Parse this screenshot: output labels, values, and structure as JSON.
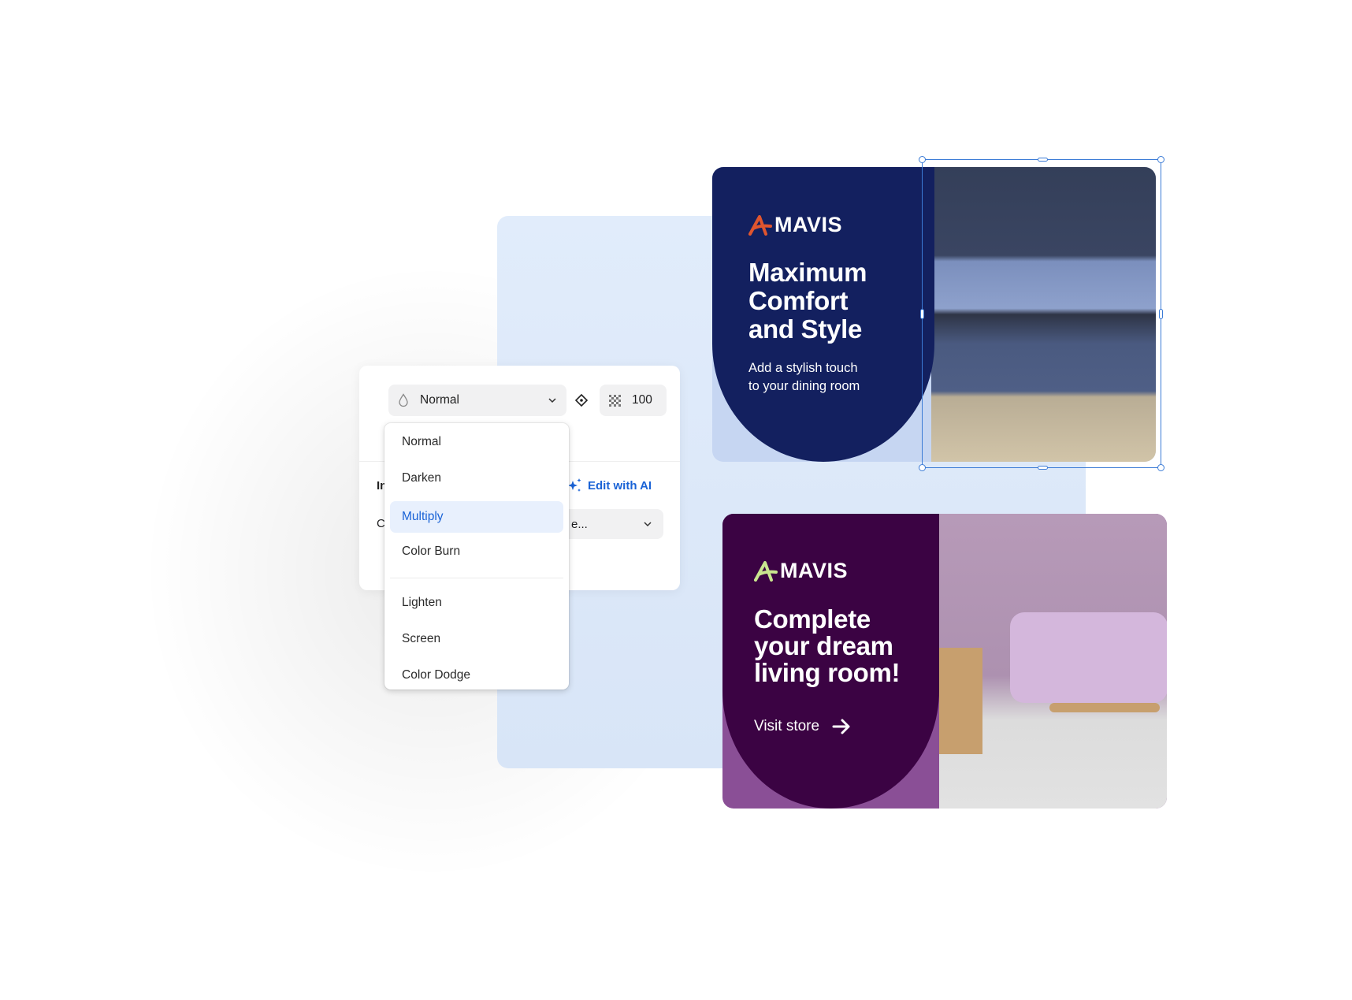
{
  "blend_panel": {
    "blend_mode": "Normal",
    "opacity": "100",
    "label_partial_1": "In",
    "label_partial_2": "C",
    "edit_ai_label": "Edit with AI",
    "second_select_value": "e..."
  },
  "dropdown": {
    "items": [
      "Normal",
      "Darken",
      "Multiply",
      "Color Burn",
      "Lighten",
      "Screen",
      "Color Dodge"
    ],
    "selected": "Multiply"
  },
  "card1": {
    "brand": "MAVIS",
    "headline": [
      "Maximum",
      "Comfort",
      "and Style"
    ],
    "subtitle": [
      "Add a stylish touch",
      "to your dining room"
    ],
    "colors": {
      "background": "#13205f",
      "logo_mark": "#e0552e"
    }
  },
  "card2": {
    "brand": "MAVIS",
    "headline": [
      "Complete",
      "your dream",
      "living room!"
    ],
    "cta": "Visit store",
    "colors": {
      "background": "#3b0343",
      "logo_mark": "#c9e58f"
    }
  },
  "accent_color": "#1a63d6"
}
